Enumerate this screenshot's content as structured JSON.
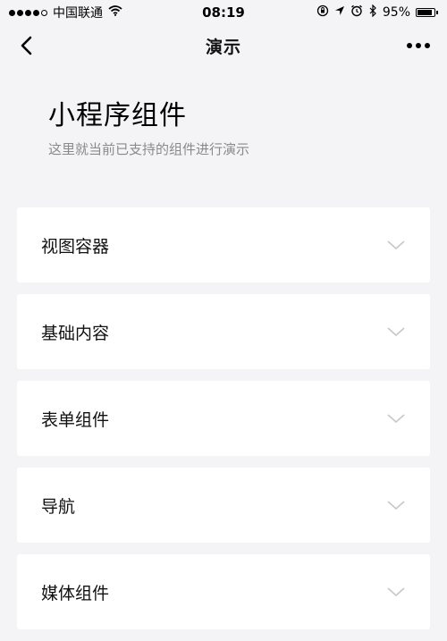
{
  "status_bar": {
    "carrier": "中国联通",
    "time": "08:19",
    "battery": "95%",
    "battery_level": 0.95,
    "icons": [
      "signal-dots-icon",
      "wifi-icon",
      "rotation-lock-icon",
      "location-icon",
      "alarm-icon",
      "bluetooth-icon",
      "battery-icon"
    ]
  },
  "nav": {
    "title": "演示",
    "back_icon": "chevron-left-icon",
    "more_icon": "more-dots-icon"
  },
  "header": {
    "title": "小程序组件",
    "description": "这里就当前已支持的组件进行演示"
  },
  "list": {
    "items": [
      {
        "label": "视图容器",
        "icon": "chevron-down-icon"
      },
      {
        "label": "基础内容",
        "icon": "chevron-down-icon"
      },
      {
        "label": "表单组件",
        "icon": "chevron-down-icon"
      },
      {
        "label": "导航",
        "icon": "chevron-down-icon"
      },
      {
        "label": "媒体组件",
        "icon": "chevron-down-icon"
      }
    ]
  },
  "colors": {
    "background": "#f4f3f6",
    "card": "#ffffff",
    "text": "#111111",
    "muted": "#8a8a8a",
    "chevron": "#c8c8c8"
  }
}
